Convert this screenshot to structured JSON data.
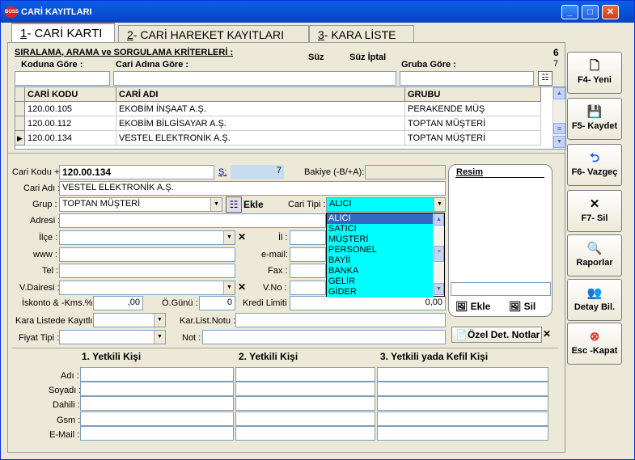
{
  "window": {
    "title": "CARİ KAYITLARI",
    "logo_text": "BOSS",
    "min": "_",
    "max": "□",
    "close": "✕"
  },
  "tabs": [
    {
      "key": "1",
      "label": "- CARİ KARTI"
    },
    {
      "key": "2",
      "label": "- CARİ HAREKET KAYITLARI"
    },
    {
      "key": "3",
      "label": "- KARA LİSTE"
    }
  ],
  "filter": {
    "title": "SIRALAMA, ARAMA ve SORGULAMA KRİTERLERİ :",
    "by_code": "Koduna Göre :",
    "by_name": "Cari Adına Göre :",
    "suz": "Süz",
    "suz_iptal": "Süz İptal",
    "by_group": "Gruba Göre :",
    "count_total": "6",
    "count_filtered": "7"
  },
  "grid": {
    "headers": [
      "CARİ KODU",
      "CARİ ADI",
      "GRUBU"
    ],
    "rows": [
      {
        "code": "120.00.105",
        "name": "EKOBİM İNŞAAT A.Ş.",
        "group": "PERAKENDE MÜŞ"
      },
      {
        "code": "120.00.112",
        "name": "EKOBİM BİLGİSAYAR A.Ş.",
        "group": "TOPTAN MÜŞTERİ"
      },
      {
        "code": "120.00.134",
        "name": "VESTEL ELEKTRONİK A.Ş.",
        "group": "TOPTAN MÜŞTERİ"
      }
    ],
    "current_indicator": "▶"
  },
  "form": {
    "cari_kodu_label": "Cari Kodu +",
    "cari_kodu": "120.00.134",
    "s_label": "Ş:",
    "s_value": "7",
    "bakiye_label": "Bakiye (-B/+A):",
    "cari_adi_label": "Cari Adı :",
    "cari_adi": "VESTEL ELEKTRONİK A.Ş.",
    "grup_label": "Grup :",
    "grup": "TOPTAN MÜŞTERİ",
    "ekle": "Ekle",
    "cari_tipi_label": "Cari Tipi :",
    "cari_tipi": "ALICI",
    "adres_label": "Adresi :",
    "ilce_label": "İlçe :",
    "il_label": "İl :",
    "www_label": "www :",
    "email_label": "e-mail:",
    "tel_label": "Tel :",
    "fax_label": "Fax :",
    "vdairesi_label": "V.Dairesi :",
    "vno_label": "V.No :",
    "iskonto_label": "İskonto & -Kms.%:",
    "iskonto": ",00",
    "ogunu_label": "Ö.Günü :",
    "ogunu": "0",
    "kredi_label": "Kredi Limiti :",
    "kredi": "0,00",
    "kara_label": "Kara Listede Kayıtlı :",
    "karlist_label": "Kar.List.Notu :",
    "fiyat_label": "Fiyat Tipi :",
    "not_label": "Not :",
    "ozel_btn": "Özel Det. Notlar"
  },
  "cari_tipi_options": [
    "ALICI",
    "SATICI",
    "MÜŞTERİ",
    "PERSONEL",
    "BAYİİ",
    "BANKA",
    "GELİR",
    "GİDER"
  ],
  "resim": {
    "label": "Resim",
    "ekle": "Ekle",
    "sil": "Sil"
  },
  "contacts": {
    "headers": [
      "1. Yetkili Kişi",
      "2. Yetkili Kişi",
      "3. Yetkili yada Kefil Kişi"
    ],
    "fields": [
      "Adı :",
      "Soyadı :",
      "Dahili :",
      "Gsm :",
      "E-Mail :"
    ]
  },
  "side_buttons": [
    {
      "label": "F4- Yeni",
      "icon": "new-doc-icon"
    },
    {
      "label": "F5- Kaydet",
      "icon": "save-icon"
    },
    {
      "label": "F6- Vazgeç",
      "icon": "undo-icon"
    },
    {
      "label": "F7- Sil",
      "icon": "delete-icon"
    },
    {
      "label": "Raporlar",
      "icon": "report-icon"
    },
    {
      "label": "Detay Bil.",
      "icon": "detail-icon"
    },
    {
      "label": "Esc -Kapat",
      "icon": "close-icon"
    }
  ]
}
